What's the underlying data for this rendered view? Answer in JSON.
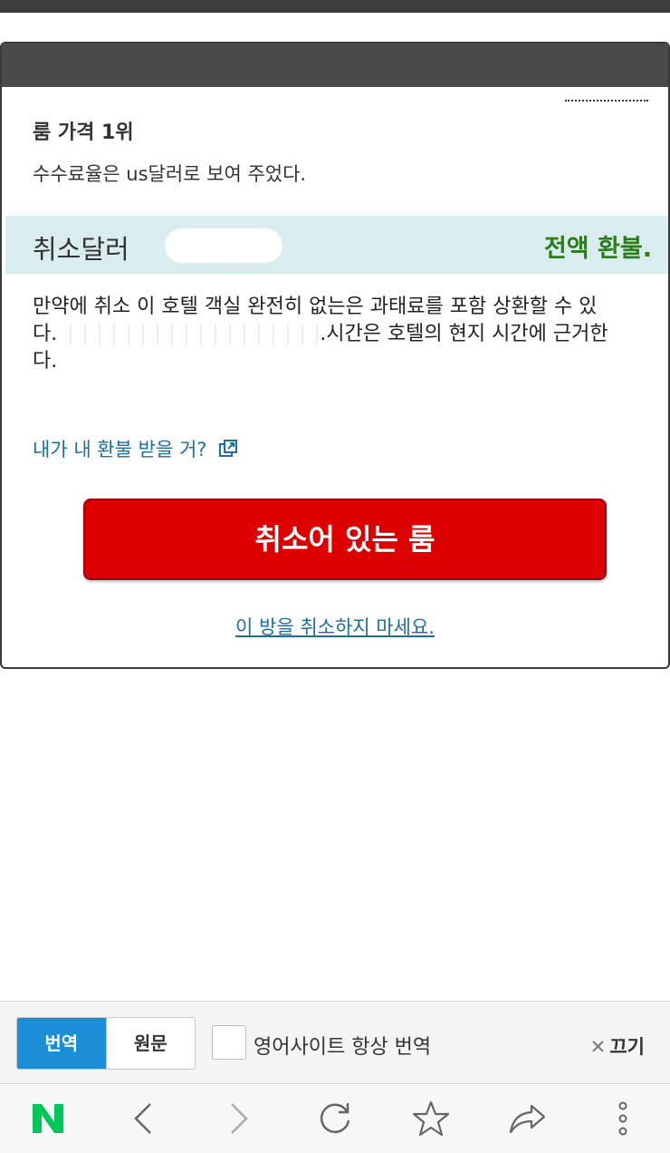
{
  "dialog": {
    "rank_heading": "룸 가격 1위",
    "fee_note": "수수료율은 us달러로 보여 주었다.",
    "cancel_label": "취소달러",
    "refund_status": "전액 환불.",
    "policy_line1": "만약에 취소 이 호텔 객실 완전히 없는은 과태료를 포함 상환할 수 있",
    "policy_line2_start": "다.",
    "policy_line2_end": ".시간은 호텔의 현지 시간에 근거한",
    "policy_line3": "다.",
    "refund_link": "내가 내 환불 받을 거?",
    "cancel_button": "취소어 있는 룸",
    "keep_link": "이 방을 취소하지 마세요."
  },
  "translate_bar": {
    "translate_tab": "번역",
    "original_tab": "원문",
    "always_translate_label": "영어사이트 항상 번역",
    "always_translate_checked": false,
    "close_label": "끄기",
    "accent_color": "#1a8fd8"
  },
  "nav": {
    "icons": [
      "naver-logo-icon",
      "back-icon",
      "forward-icon",
      "refresh-icon",
      "bookmark-star-icon",
      "share-icon",
      "more-icon"
    ],
    "brand_color": "#03c75a"
  },
  "colors": {
    "cancel_button_bg": "#dd0000",
    "refund_text": "#2e7d1a",
    "link": "#1a6fa0",
    "band_bg": "#d9ecef"
  }
}
